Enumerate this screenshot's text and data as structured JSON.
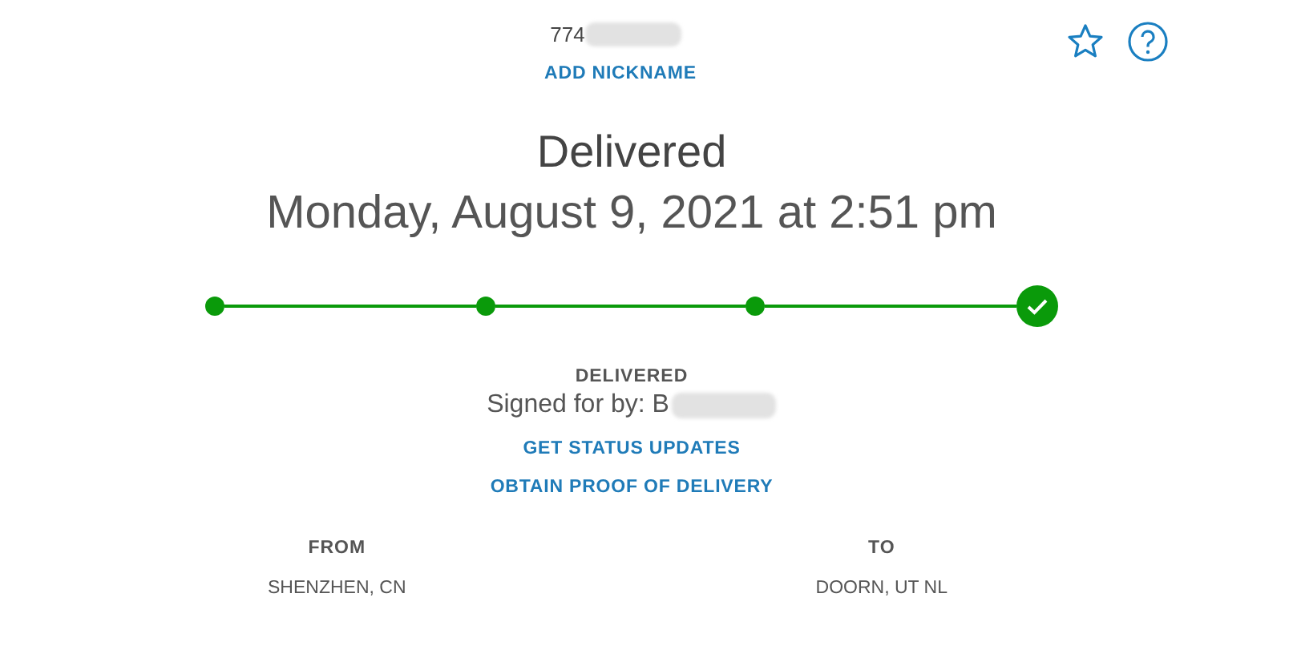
{
  "tracking_number": "774",
  "nickname_link": "ADD NICKNAME",
  "status": "Delivered",
  "delivered_at": "Monday, August 9, 2021 at 2:51 pm",
  "progress": [
    {
      "completed": true,
      "current": false
    },
    {
      "completed": true,
      "current": false
    },
    {
      "completed": true,
      "current": false
    },
    {
      "completed": true,
      "current": true
    }
  ],
  "status_label": "DELIVERED",
  "signed_for": "Signed for by: B",
  "links": [
    "GET STATUS UPDATES",
    "OBTAIN PROOF OF DELIVERY"
  ],
  "from": {
    "label": "FROM",
    "value": "SHENZHEN, CN"
  },
  "to": {
    "label": "TO",
    "value": "DOORN, UT NL"
  }
}
